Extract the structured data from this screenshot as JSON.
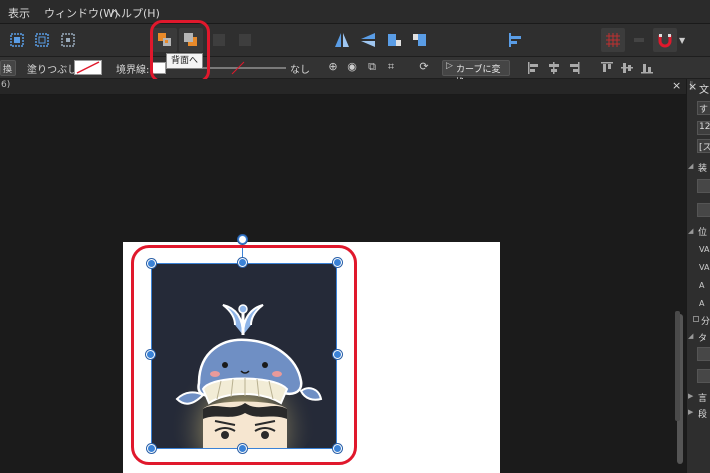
{
  "menubar": {
    "items": [
      {
        "label": "表示"
      },
      {
        "label": "ウィンドウ(W)"
      },
      {
        "label": "ヘルプ(H)"
      }
    ]
  },
  "toolbar": {
    "tooltip": "背面へ"
  },
  "context_bar": {
    "left_truncated": "換",
    "fill_label": "塗りつぶし:",
    "stroke_label": "境界線:",
    "stroke_value": "なし",
    "convert_curve_label": "カーブに変換"
  },
  "tab_bar": {
    "left_fragment": "6)",
    "close_symbol": "×"
  },
  "right_panel": {
    "header": "文",
    "fields": [
      "す",
      "12",
      "[ス"
    ],
    "section_decor": "装",
    "section_position": "位",
    "row_labels": [
      "VA",
      "VA",
      "A",
      "A"
    ],
    "checkbox_label": "分",
    "section_text": "タ",
    "collapsed_items": [
      "言",
      "段"
    ],
    "close_symbol": "×"
  },
  "colors": {
    "highlight_red": "#e0182c",
    "selection_blue": "#3b82d6"
  }
}
